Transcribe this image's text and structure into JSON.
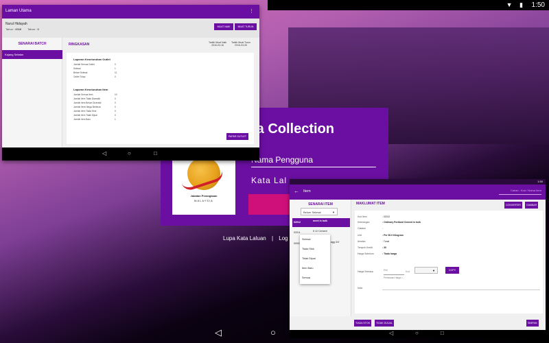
{
  "system": {
    "time": "1:50",
    "time_small": "1:49",
    "w2_time": "1:50"
  },
  "login": {
    "title_partial": "ta Collection",
    "username_placeholder": "Nama Pengguna",
    "password_placeholder": "Kata Lal",
    "logo_line1": "Jabatan Perangkaan",
    "logo_line2": "MALAYSIA",
    "link_forgot": "Lupa Kata Laluan",
    "link_sep": "|",
    "link_log": "Log"
  },
  "win1": {
    "title": "Laman Utama",
    "user_name": "Nurul Hidayah",
    "tahun_label": "Tahun :",
    "tahun_value": "2016",
    "tahun2_label": "Tahun :",
    "tahun2_value": "0",
    "btn_muat_naik": "MUAT NAIK",
    "btn_muat_turun": "MUAT TURUN",
    "side_header": "SENARAI BATCH",
    "side_item": "Kajang Selatan",
    "main_header": "RINGKASAN",
    "date_mula_label": "Tarikh Muat Naik",
    "date_mula_value": "2016-03-16",
    "date_turun_label": "Tarikh Muat Turun",
    "date_turun_value": "2016-03-30",
    "section1": "Laporan Keseluruhan Outlet",
    "rows1": [
      {
        "label": "Jumlah Semua Outlet",
        "value": "0"
      },
      {
        "label": "Selesai",
        "value": "1"
      },
      {
        "label": "Belum Selesai",
        "value": "11"
      },
      {
        "label": "Outlet Tutup",
        "value": "0"
      }
    ],
    "section2": "Laporan Keseluruhan Item",
    "rows2": [
      {
        "label": "Jumlah Semua Item",
        "value": "10"
      },
      {
        "label": "Jumlah Item Tidak Dicerakil",
        "value": "0"
      },
      {
        "label": "Jumlah Item Belum Dicerakil",
        "value": "0"
      },
      {
        "label": "Jumlah Item Harga Berbeza",
        "value": "0"
      },
      {
        "label": "Jumlah Item Tiada Stok",
        "value": "0"
      },
      {
        "label": "Jumlah Item Tidak Dijual",
        "value": "0"
      },
      {
        "label": "Jumlah Item Baru",
        "value": "1"
      }
    ],
    "btn_papar_outlet": "PAPAR OUTLET"
  },
  "win2": {
    "title": "Item",
    "search_placeholder": "Carian : Kod / Nama Item",
    "side_header": "SENARAI ITEM",
    "filter_value": "Belum Selesai",
    "items": [
      {
        "code": "02012",
        "name": "ment in bulk",
        "active": true
      },
      {
        "code": "02011",
        "name": "5 12 Cement",
        "active": false
      },
      {
        "code": "00001",
        "name": "Aggregate 40% agg 3/4'",
        "active": false
      }
    ],
    "dropdown_options": [
      "Selesai",
      "Tiada Stok",
      "Tidak Dijual",
      "Item Baru",
      "Semua"
    ],
    "main_header": "MAKLUMAT ITEM",
    "btn_convert": "CONVERTER",
    "btn_gambar": "GAMBAR",
    "fields": [
      {
        "label": "Kod Item",
        "value": ": 02012"
      },
      {
        "label": "Keterangan",
        "value": ": Ordinary Portland Cement in bulk"
      },
      {
        "label": "Catatan",
        "value": ":"
      },
      {
        "label": "Unit",
        "value": ": Per 50.0 Kilogram"
      },
      {
        "label": "Amalan",
        "value": ": Tunai"
      },
      {
        "label": "Tempoh Kredit",
        "value": ": 30"
      },
      {
        "label": "Harga Sebelum",
        "value": ": Tiada harga"
      }
    ],
    "harga_semasa_label": "Harga Semasa",
    "rm_placeholder": "RM",
    "kod_label": "Kod",
    "btn_copy": "COPY",
    "perbezaan": "Perbezaan Harga = -",
    "nota_label": "Nota",
    "btn_tiada_stok": "TIADA STOK",
    "btn_tidak_dijual": "TIDAK DIJUAL",
    "btn_simpan": "SIMPAN"
  }
}
